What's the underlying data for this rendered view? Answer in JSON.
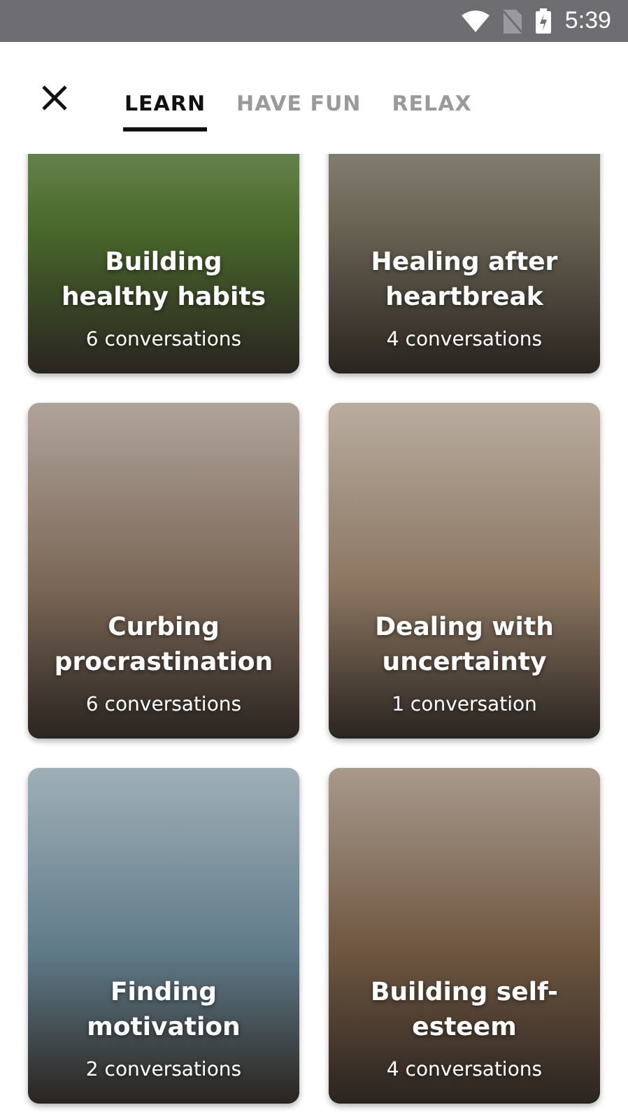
{
  "status_bar": {
    "time": "5:39"
  },
  "tabs": [
    {
      "label": "LEARN",
      "selected": true
    },
    {
      "label": "HAVE FUN",
      "selected": false
    },
    {
      "label": "RELAX",
      "selected": false
    }
  ],
  "cards": [
    {
      "title": "Building healthy habits",
      "count": "6 conversations",
      "color": "#4a6b2c"
    },
    {
      "title": "Healing after heartbreak",
      "count": "4 conversations",
      "color": "#6b6555"
    },
    {
      "title": "Curbing procrastination",
      "count": "6 conversations",
      "color": "#7a6656"
    },
    {
      "title": "Dealing with uncertainty",
      "count": "1 conversation",
      "color": "#8a7560"
    },
    {
      "title": "Finding motivation",
      "count": "2 conversations",
      "color": "#5f7a88"
    },
    {
      "title": "Building self-esteem",
      "count": "4 conversations",
      "color": "#6e5640"
    }
  ]
}
